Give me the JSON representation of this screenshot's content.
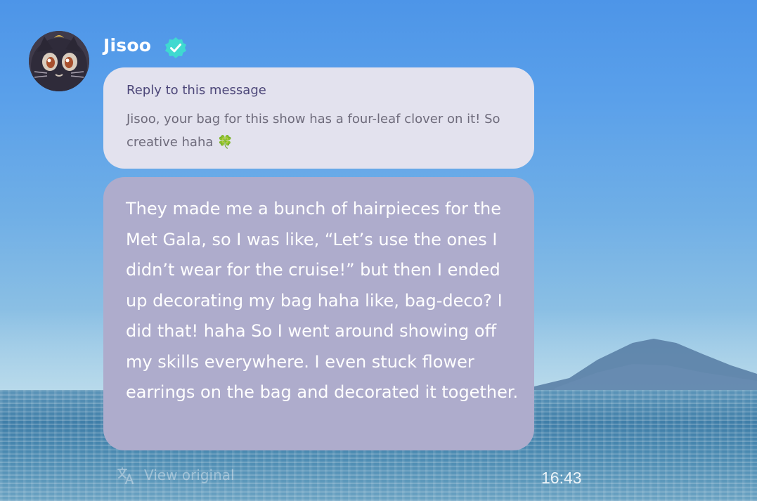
{
  "sender": {
    "name": "Jisoo",
    "verified": true,
    "avatar_icon": "cat-avatar",
    "verified_icon": "verified-badge-icon"
  },
  "reply": {
    "label": "Reply to this message",
    "quote": "Jisoo, your bag for this show has a four-leaf clover on it! So creative haha 🍀"
  },
  "message": {
    "text": "They made me a bunch of hairpieces for the Met Gala, so I was like, “Let’s use the ones I didn’t wear for the cruise!” but then I ended up decorating my bag haha like, bag-deco? I did that! haha So I went around showing off my skills everywhere. I even stuck flower earrings on the bag and decorated it together."
  },
  "footer": {
    "translate_label": "View original",
    "translate_icon": "translate-icon",
    "timestamp": "16:43"
  },
  "colors": {
    "reply_bubble": "#e3e2ee",
    "message_bubble": "#aeaccc",
    "verified": "#3fd9d0",
    "reply_label": "#4d4779"
  }
}
